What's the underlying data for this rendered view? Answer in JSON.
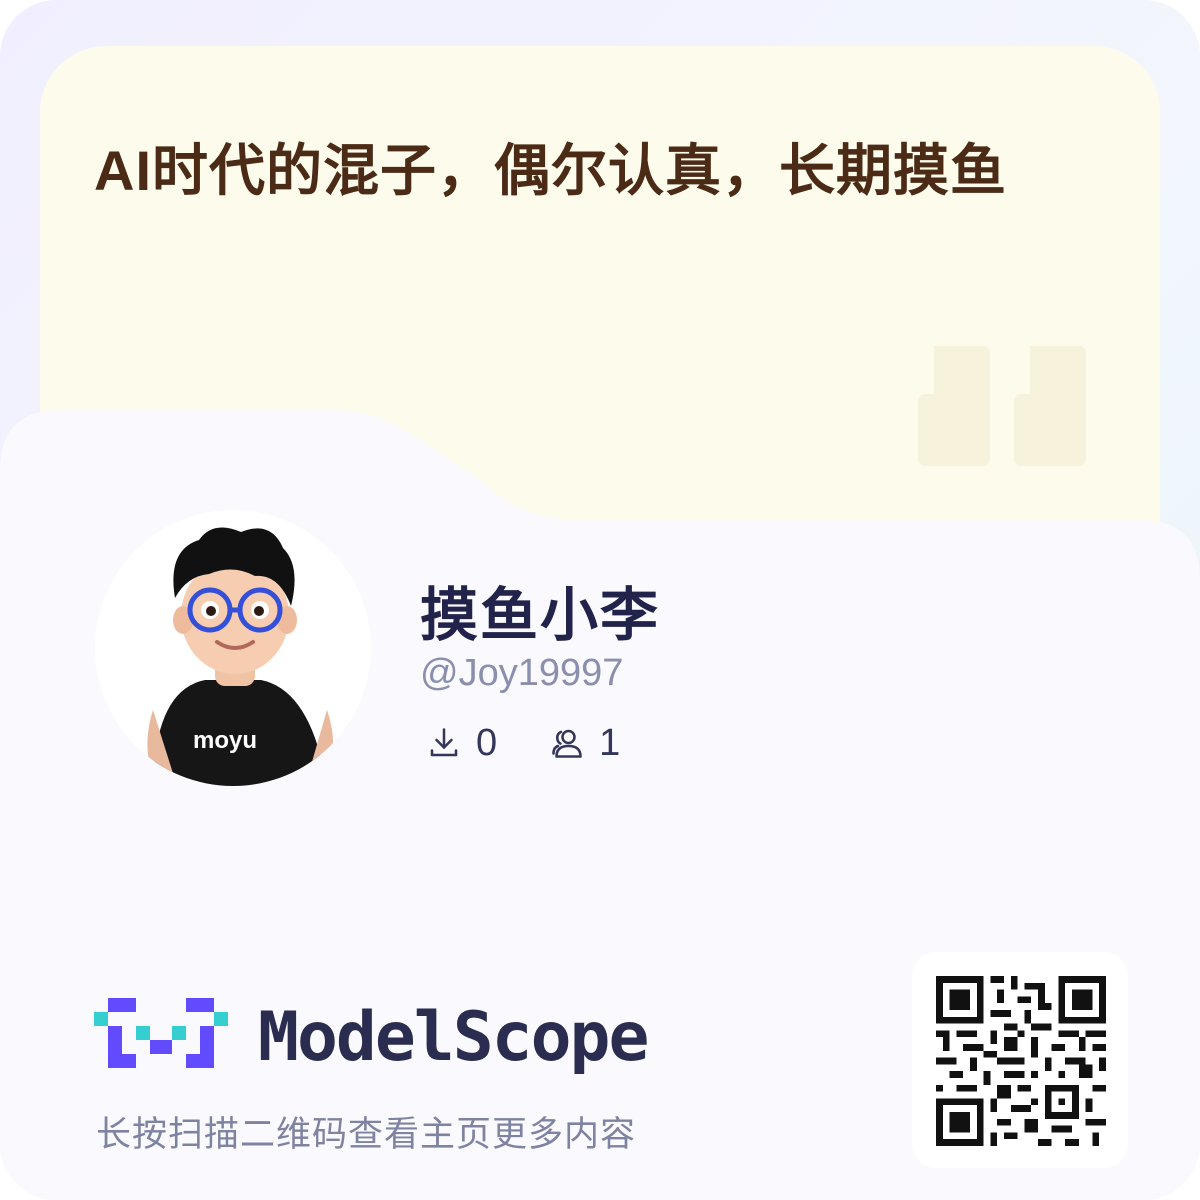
{
  "quote": {
    "text": "AI时代的混子，偶尔认真，长期摸鱼",
    "mark_icon": "quote-mark-icon"
  },
  "profile": {
    "name": "摸鱼小李",
    "handle": "@Joy19997",
    "avatar_shirt_text": "moyu",
    "avatar_icon": "cartoon-avatar",
    "stats": [
      {
        "icon": "download-icon",
        "value": "0"
      },
      {
        "icon": "followers-icon",
        "value": "1"
      }
    ]
  },
  "footer": {
    "logo_text": "ModelScope",
    "logo_icon": "modelscope-logo-icon",
    "scan_hint": "长按扫描二维码查看主页更多内容",
    "qr_icon": "qr-code"
  },
  "colors": {
    "quote_bg": "#fdfbec",
    "quote_text": "#4b2a16",
    "card_bg": "#f9f9fe",
    "name_text": "#22234a",
    "handle_text": "#8b8fae",
    "logo_purple": "#624aff",
    "logo_teal": "#36cfd1"
  }
}
